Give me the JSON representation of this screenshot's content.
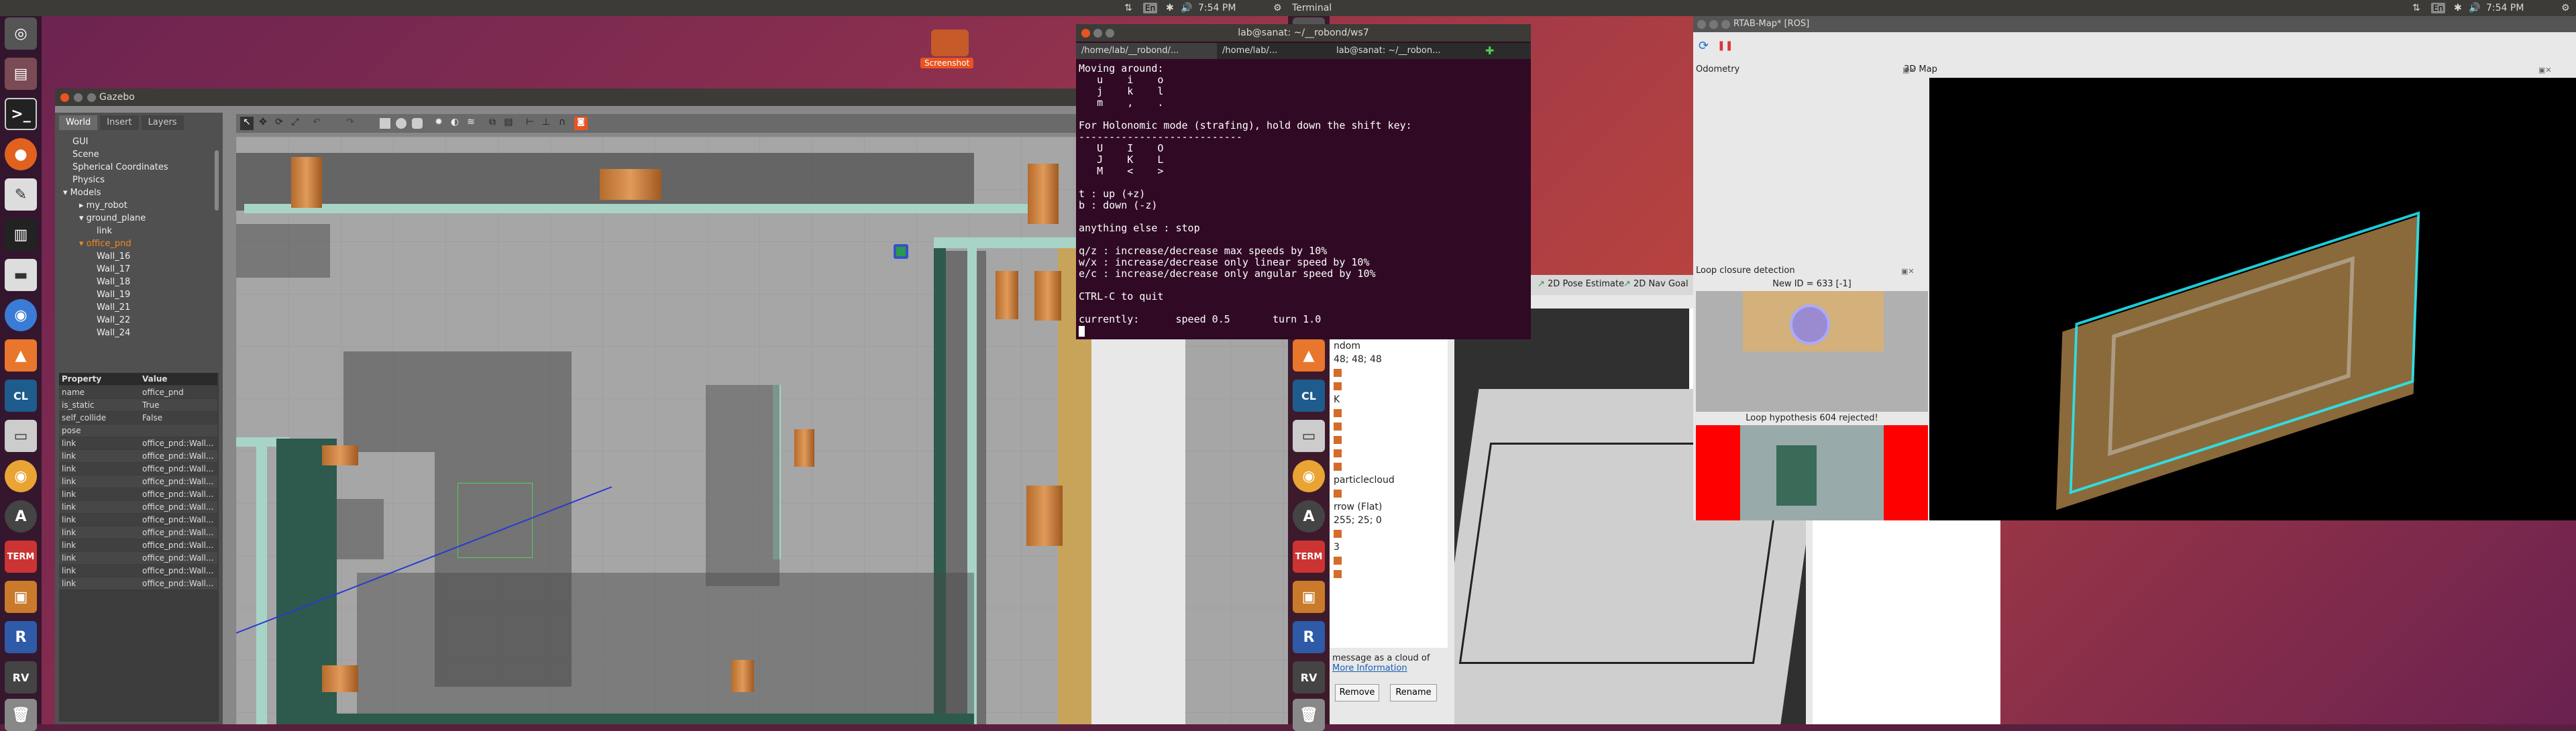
{
  "top_panel": {
    "active_app": "Terminal",
    "left_time": "7:54 PM",
    "right_time": "7:54 PM",
    "left_indicators": [
      "⇅",
      "En",
      "✱",
      "🔊"
    ],
    "right_indicators": [
      "⇅",
      "En",
      "✱",
      "🔊"
    ]
  },
  "desktop": {
    "screenshot_label": "Screenshot"
  },
  "gazebo": {
    "title": "Gazebo",
    "tabs": [
      "World",
      "Insert",
      "Layers"
    ],
    "tree": [
      "GUI",
      "Scene",
      "Spherical Coordinates",
      "Physics",
      "Models",
      "my_robot",
      "ground_plane",
      "link",
      "office_pnd",
      "Wall_16",
      "Wall_17",
      "Wall_18",
      "Wall_19",
      "Wall_21",
      "Wall_22",
      "Wall_24"
    ],
    "prop_header": [
      "Property",
      "Value"
    ],
    "props": [
      {
        "k": "name",
        "v": "office_pnd"
      },
      {
        "k": "is_static",
        "v": "True"
      },
      {
        "k": "self_collide",
        "v": "False"
      },
      {
        "k": "pose",
        "v": ""
      },
      {
        "k": "link",
        "v": "office_pnd::Wall..."
      },
      {
        "k": "link",
        "v": "office_pnd::Wall..."
      },
      {
        "k": "link",
        "v": "office_pnd::Wall..."
      },
      {
        "k": "link",
        "v": "office_pnd::Wall..."
      },
      {
        "k": "link",
        "v": "office_pnd::Wall..."
      },
      {
        "k": "link",
        "v": "office_pnd::Wall..."
      },
      {
        "k": "link",
        "v": "office_pnd::Wall..."
      },
      {
        "k": "link",
        "v": "office_pnd::Wall..."
      },
      {
        "k": "link",
        "v": "office_pnd::Wall..."
      },
      {
        "k": "link",
        "v": "office_pnd::Wall..."
      },
      {
        "k": "link",
        "v": "office_pnd::Wall..."
      },
      {
        "k": "link",
        "v": "office_pnd::Wall..."
      }
    ]
  },
  "terminal": {
    "title": "lab@sanat: ~/__robond/ws7",
    "tabs": [
      "/home/lab/__robond/...",
      "/home/lab/...",
      "lab@sanat: ~/__robon..."
    ],
    "lines": [
      "Moving around:",
      "   u    i    o",
      "   j    k    l",
      "   m    ,    .",
      "",
      "For Holonomic mode (strafing), hold down the shift key:",
      "---------------------------",
      "   U    I    O",
      "   J    K    L",
      "   M    <    >",
      "",
      "t : up (+z)",
      "b : down (-z)",
      "",
      "anything else : stop",
      "",
      "q/z : increase/decrease max speeds by 10%",
      "w/x : increase/decrease only linear speed by 10%",
      "e/c : increase/decrease only angular speed by 10%",
      "",
      "CTRL-C to quit",
      "",
      "currently:      speed 0.5       turn 1.0"
    ]
  },
  "rviz": {
    "toolbar": [
      "2D Pose Estimate",
      "2D Nav Goal"
    ],
    "rows": [
      "ndom",
      "48; 48; 48",
      "",
      "",
      "K",
      "",
      "",
      "",
      "",
      "",
      "particlecloud",
      "",
      "rrow (Flat)",
      "255; 25; 0",
      "",
      "3",
      "",
      ""
    ],
    "help": "message as a cloud of",
    "help_link": "More Information",
    "remove_button": "Remove",
    "rename_button": "Rename"
  },
  "rtabmap": {
    "title": "RTAB-Map* [ROS]",
    "odometry_label": "Odometry",
    "map_label": "3D Map",
    "loop_label": "Loop closure detection",
    "new_id": "New ID = 633 [-1]",
    "loop_rejected": "Loop hypothesis 604 rejected!"
  },
  "colors": {
    "accent": "#e95420",
    "panel": "#3c3b37",
    "terminal_bg": "#300a24"
  }
}
